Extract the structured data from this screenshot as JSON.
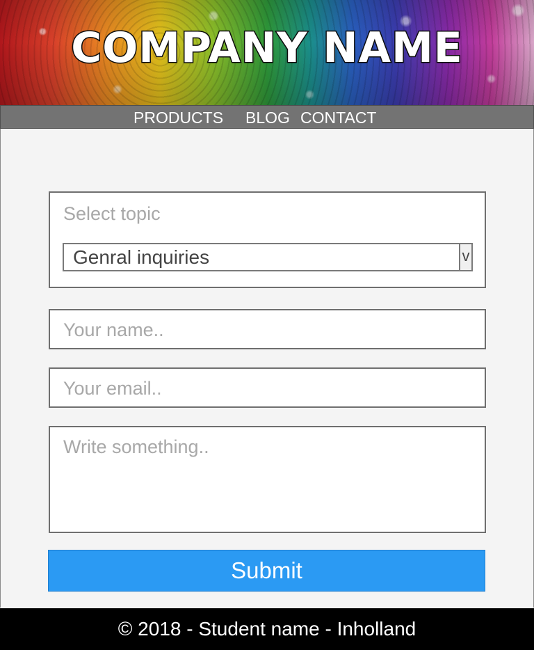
{
  "header": {
    "brand": "COMPANY NAME"
  },
  "nav": {
    "items": [
      "PRODUCTS",
      "BLOG",
      "CONTACT"
    ]
  },
  "form": {
    "topic_label": "Select topic",
    "topic_selected": "Genral inquiries",
    "topic_arrow": "v",
    "name_placeholder": "Your name..",
    "email_placeholder": "Your email..",
    "message_placeholder": "Write something..",
    "submit_label": "Submit"
  },
  "footer": {
    "text": "© 2018 - Student name - Inholland"
  },
  "colors": {
    "nav_bg": "#737373",
    "submit_bg": "#2b9af3",
    "footer_bg": "#000000",
    "content_bg": "#f4f4f4"
  }
}
